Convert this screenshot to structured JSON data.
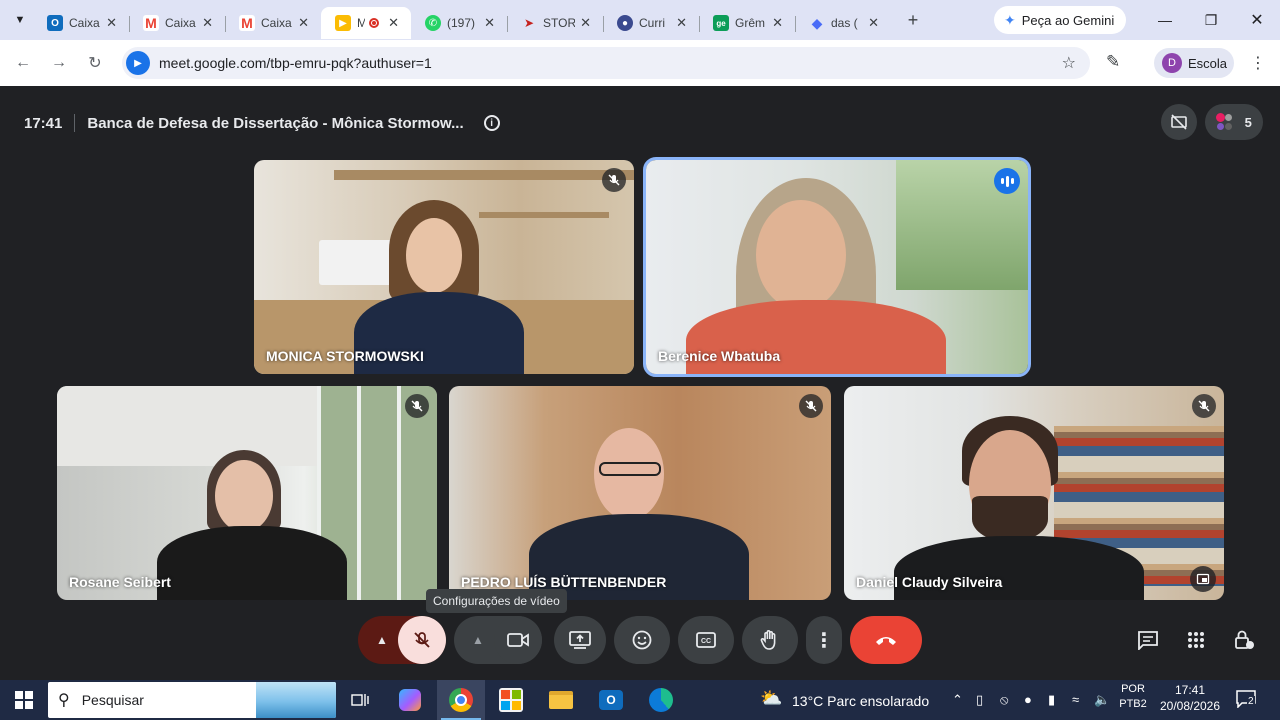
{
  "browser": {
    "tabs": [
      {
        "title": "Caixa",
        "icon": "outlook-icon",
        "color": "#0f6cbd"
      },
      {
        "title": "Caixa",
        "icon": "gmail-icon",
        "color": "#ea4335"
      },
      {
        "title": "Caixa",
        "icon": "gmail-icon",
        "color": "#ea4335"
      },
      {
        "title": "M",
        "icon": "meet-icon",
        "color": "#fbbc04",
        "active": true,
        "recording": true
      },
      {
        "title": "(197)",
        "icon": "whatsapp-icon",
        "color": "#25d366"
      },
      {
        "title": "STOR",
        "icon": "stor-icon",
        "color": "#3c4043"
      },
      {
        "title": "Curri",
        "icon": "lattes-icon",
        "color": "#3b4a8f"
      },
      {
        "title": "Grêm",
        "icon": "ge-icon",
        "color": "#0c9d58"
      },
      {
        "title": "das (",
        "icon": "diamond-icon",
        "color": "#4a6cf7"
      }
    ],
    "tab_close": "✕",
    "new_tab": "+",
    "gemini_label": "Peça ao Gemini",
    "url": "meet.google.com/tbp-emru-pqk?authuser=1",
    "profile_initial": "D",
    "profile_label": "Escola"
  },
  "meet": {
    "time": "17:41",
    "meeting_title": "Banca de Defesa de Dissertação - Mônica Stormow...",
    "participant_count": "5",
    "participants": [
      {
        "name": "MONICA STORMOWSKI",
        "mic": "off"
      },
      {
        "name": "Berenice Wbatuba",
        "mic": "speaking"
      },
      {
        "name": "Rosane Seibert",
        "mic": "off"
      },
      {
        "name": "PEDRO LUÍS BÜTTENBENDER",
        "mic": "off"
      },
      {
        "name": "Daniel Claudy Silveira",
        "mic": "off"
      }
    ],
    "tooltip": "Configurações de vídeo",
    "colors": {
      "hangup": "#ea4335",
      "mic_off": "#f9dedc",
      "mic_off_dark": "#5c1a14",
      "accent": "#8ab4f8"
    }
  },
  "taskbar": {
    "search_placeholder": "Pesquisar",
    "weather": "13°C  Parc ensolarado",
    "lang_top": "POR",
    "lang_bottom": "PTB2",
    "clock_time": "17:41",
    "clock_date": "20/08/2026",
    "notifications": "2"
  }
}
